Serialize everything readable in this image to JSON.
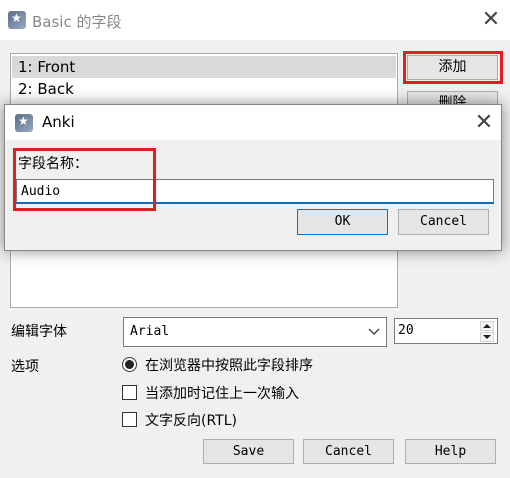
{
  "window": {
    "title": "Basic 的字段",
    "close_glyph": "✕"
  },
  "fields_list": {
    "items": [
      {
        "label": "1: Front",
        "selected": true
      },
      {
        "label": "2: Back",
        "selected": false
      }
    ]
  },
  "side_buttons": {
    "add_label": "添加",
    "delete_label": "删除"
  },
  "dialog": {
    "title": "Anki",
    "close_glyph": "✕",
    "field_label": "字段名称：",
    "input_value": "Audio",
    "ok_label": "OK",
    "cancel_label": "Cancel"
  },
  "editor_font": {
    "label": "编辑字体",
    "font_value": "Arial",
    "size_value": "20"
  },
  "options": {
    "label": "选项",
    "sort_label": "在浏览器中按照此字段排序",
    "sort_checked": true,
    "remember_label": "当添加时记住上一次输入",
    "remember_checked": false,
    "rtl_label": "文字反向(RTL)",
    "rtl_checked": false
  },
  "footer": {
    "save_label": "Save",
    "cancel_label": "Cancel",
    "help_label": "Help"
  },
  "colors": {
    "highlight": "#e02020",
    "focus": "#0c6cc0",
    "selection": "#d9d9d9"
  },
  "icons": [
    "anki-icon",
    "close-icon",
    "chevron-down-icon",
    "spin-up-icon",
    "spin-down-icon"
  ]
}
